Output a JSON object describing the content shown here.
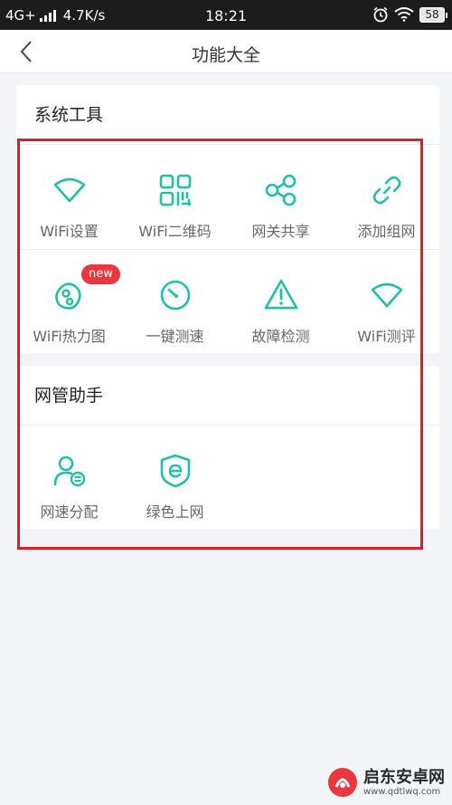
{
  "status_bar": {
    "network": "4G+",
    "speed": "4.7K/s",
    "time": "18:21",
    "battery": "58"
  },
  "nav": {
    "title": "功能大全"
  },
  "system_tools": {
    "title": "系统工具",
    "items": [
      {
        "label": "WiFi设置",
        "icon": "wifi-icon"
      },
      {
        "label": "WiFi二维码",
        "icon": "qr-code-icon"
      },
      {
        "label": "网关共享",
        "icon": "share-icon"
      },
      {
        "label": "添加组网",
        "icon": "link-icon"
      },
      {
        "label": "WiFi热力图",
        "icon": "heatmap-icon",
        "badge": "new"
      },
      {
        "label": "一键测速",
        "icon": "speedometer-icon"
      },
      {
        "label": "故障检测",
        "icon": "warning-icon"
      },
      {
        "label": "WiFi测评",
        "icon": "wifi-icon"
      }
    ]
  },
  "network_assistant": {
    "title": "网管助手",
    "items": [
      {
        "label": "网速分配",
        "icon": "user-settings-icon"
      },
      {
        "label": "绿色上网",
        "icon": "shield-e-icon"
      }
    ]
  },
  "watermark": {
    "name": "启东安卓网",
    "url": "www.qdtlwq.com"
  },
  "colors": {
    "accent": "#1fbfa8",
    "highlight": "#d8202a",
    "badge": "#e8383d"
  }
}
